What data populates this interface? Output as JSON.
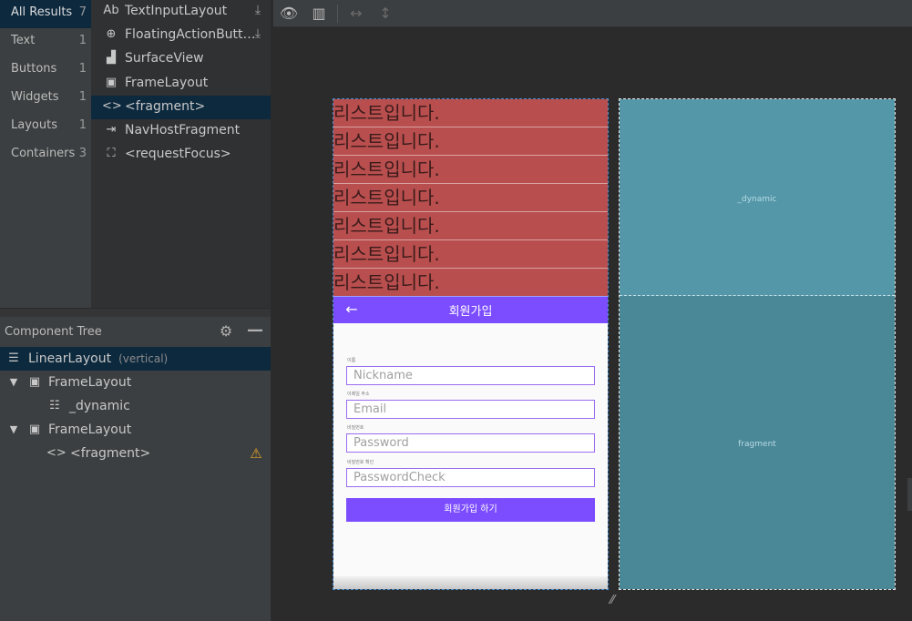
{
  "palette": {
    "categories": [
      {
        "label": "All Results",
        "count": "7"
      },
      {
        "label": "Text",
        "count": "1"
      },
      {
        "label": "Buttons",
        "count": "1"
      },
      {
        "label": "Widgets",
        "count": "1"
      },
      {
        "label": "Layouts",
        "count": "1"
      },
      {
        "label": "Containers",
        "count": "3"
      }
    ],
    "items": [
      {
        "label": "TextInputLayout",
        "icon": "Ab"
      },
      {
        "label": "FloatingActionButt…",
        "icon": "⊕"
      },
      {
        "label": "SurfaceView",
        "icon": "▟"
      },
      {
        "label": "FrameLayout",
        "icon": "▣"
      },
      {
        "label": "<fragment>",
        "icon": "<>"
      },
      {
        "label": "NavHostFragment",
        "icon": "⇥"
      },
      {
        "label": "<requestFocus>",
        "icon": "⛶"
      }
    ]
  },
  "component_tree": {
    "title": "Component Tree",
    "nodes": [
      {
        "label": "LinearLayout",
        "meta": "(vertical)"
      },
      {
        "label": "FrameLayout"
      },
      {
        "label": "_dynamic"
      },
      {
        "label": "FrameLayout"
      },
      {
        "label": "<fragment>"
      }
    ]
  },
  "preview": {
    "list_rows": [
      "리스트입니다.",
      "리스트입니다.",
      "리스트입니다.",
      "리스트입니다.",
      "리스트입니다.",
      "리스트입니다.",
      "리스트입니다."
    ],
    "appbar_title": "회원가입",
    "fields": [
      {
        "label": "이름",
        "placeholder": "Nickname"
      },
      {
        "label": "이메일 주소",
        "placeholder": "Email"
      },
      {
        "label": "비밀번호",
        "placeholder": "Password"
      },
      {
        "label": "비밀번호 확인",
        "placeholder": "PasswordCheck"
      }
    ],
    "submit_label": "회원가입 하기"
  },
  "blueprint": {
    "top_label": "_dynamic",
    "bottom_label": "fragment"
  },
  "colors": {
    "selection": "#0d293e",
    "list_bg": "#b84f4e",
    "accent": "#7c4dff",
    "blueprint_top": "#5497a9",
    "blueprint_bottom": "#4a8797",
    "warning": "#e0a527"
  }
}
